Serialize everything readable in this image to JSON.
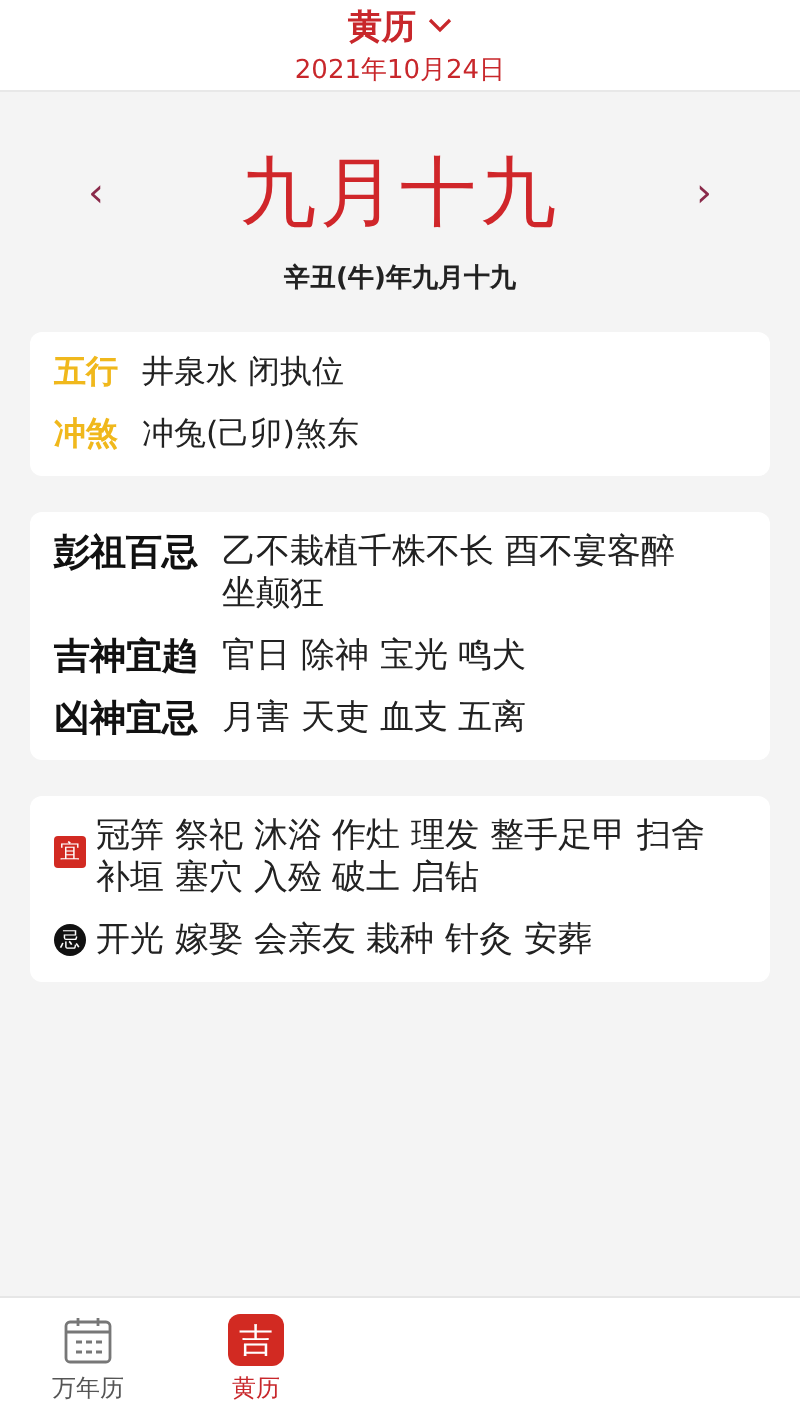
{
  "header": {
    "title": "黄历",
    "date": "2021年10月24日"
  },
  "lunar": {
    "prev": "‹",
    "next": "›",
    "day": "九月十九",
    "full": "辛丑(牛)年九月十九"
  },
  "elements": [
    {
      "label": "五行",
      "value": "井泉水 闭执位"
    },
    {
      "label": "冲煞",
      "value": "冲兔(己卯)煞东"
    }
  ],
  "deities": [
    {
      "label": "彭祖百忌",
      "value": "乙不栽植千株不长 酉不宴客醉坐颠狂"
    },
    {
      "label": "吉神宜趋",
      "value": "官日 除神 宝光 鸣犬"
    },
    {
      "label": "凶神宜忌",
      "value": "月害 天吏 血支 五离"
    }
  ],
  "activities": [
    {
      "kind": "good",
      "badge": "宜",
      "value": "冠笄 祭祀 沐浴 作灶 理发 整手足甲 扫舍补垣 塞穴 入殓 破土 启钻"
    },
    {
      "kind": "bad",
      "badge": "忌",
      "value": "开光 嫁娶 会亲友 栽种 针灸 安葬"
    }
  ],
  "tabs": [
    {
      "label": "万年历",
      "kind": "calendar",
      "selected": false
    },
    {
      "label": "黄历",
      "kind": "badge",
      "icon_text": "吉",
      "selected": true
    }
  ]
}
